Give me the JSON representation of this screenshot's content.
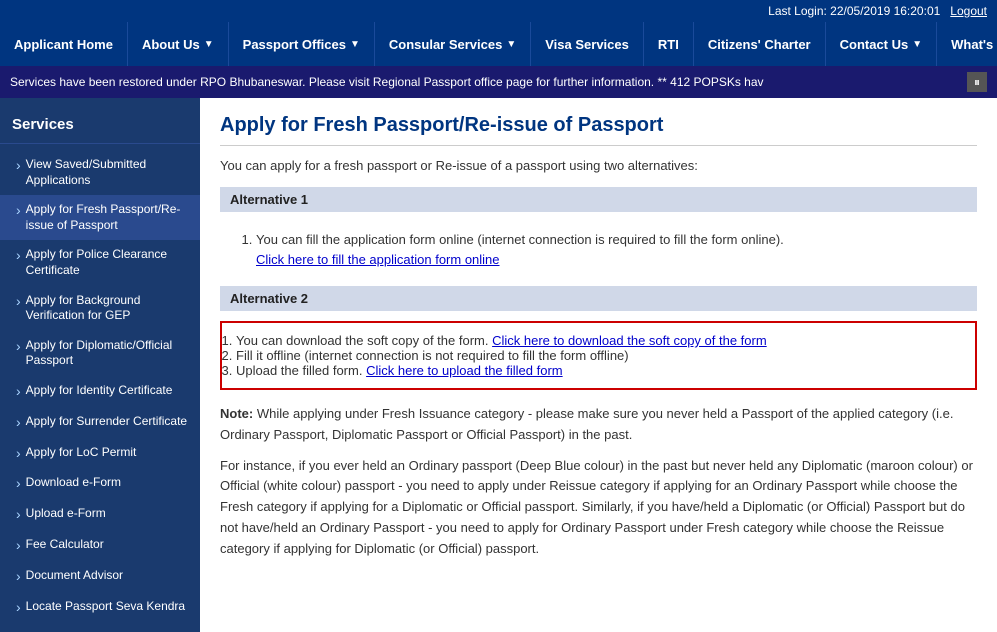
{
  "topbar": {
    "last_login": "Last Login: 22/05/2019 16:20:01",
    "logout": "Logout"
  },
  "nav": {
    "items": [
      {
        "label": "Applicant Home",
        "has_arrow": false
      },
      {
        "label": "About Us",
        "has_arrow": true
      },
      {
        "label": "Passport Offices",
        "has_arrow": true
      },
      {
        "label": "Consular Services",
        "has_arrow": true
      },
      {
        "label": "Visa Services",
        "has_arrow": false
      },
      {
        "label": "RTI",
        "has_arrow": false
      },
      {
        "label": "Citizens' Charter",
        "has_arrow": false
      },
      {
        "label": "Contact Us",
        "has_arrow": true
      },
      {
        "label": "What's New",
        "has_arrow": false
      }
    ]
  },
  "ticker": {
    "text": "Services have been restored under RPO Bhubaneswar. Please visit Regional Passport office page for further information. ** 412 POPSKs hav"
  },
  "sidebar": {
    "title": "Services",
    "items": [
      {
        "label": "View Saved/Submitted Applications"
      },
      {
        "label": "Apply for Fresh Passport/Re-issue of Passport"
      },
      {
        "label": "Apply for Police Clearance Certificate"
      },
      {
        "label": "Apply for Background Verification for GEP"
      },
      {
        "label": "Apply for Diplomatic/Official Passport"
      },
      {
        "label": "Apply for Identity Certificate"
      },
      {
        "label": "Apply for Surrender Certificate"
      },
      {
        "label": "Apply for LoC Permit"
      },
      {
        "label": "Download e-Form"
      },
      {
        "label": "Upload e-Form"
      },
      {
        "label": "Fee Calculator"
      },
      {
        "label": "Document Advisor"
      },
      {
        "label": "Locate Passport Seva Kendra"
      }
    ]
  },
  "content": {
    "title": "Apply for Fresh Passport/Re-issue of Passport",
    "intro": "You can apply for a fresh passport or Re-issue of a passport using two alternatives:",
    "alt1": {
      "header": "Alternative 1",
      "items": [
        {
          "text_before": "You can fill the application form online (internet connection is required to fill the form online).",
          "link_text": "Click here to fill the application form online",
          "text_after": ""
        }
      ]
    },
    "alt2": {
      "header": "Alternative 2",
      "items": [
        {
          "text_before": "You can download the soft copy of the form.",
          "link_text": "Click here to download the soft copy of the form",
          "text_after": ""
        },
        {
          "text_before": "Fill it offline (internet connection is not required to fill the form offline)",
          "link_text": "",
          "text_after": ""
        },
        {
          "text_before": "Upload the filled form.",
          "link_text": "Click here to upload the filled form",
          "text_after": ""
        }
      ]
    },
    "note": {
      "label": "Note:",
      "para1": "While applying under Fresh Issuance category - please make sure you never held a Passport of the applied category (i.e. Ordinary Passport, Diplomatic Passport or Official Passport) in the past.",
      "para2": "For instance, if you ever held an Ordinary passport (Deep Blue colour) in the past but never held any Diplomatic (maroon colour) or Official (white colour) passport - you need to apply under Reissue category if applying for an Ordinary Passport while choose the Fresh category if applying for a Diplomatic or Official passport. Similarly, if you have/held a Diplomatic (or Official) Passport but do not have/held an Ordinary Passport - you need to apply for Ordinary Passport under Fresh category while choose the Reissue category if applying for Diplomatic (or Official) passport."
    }
  }
}
